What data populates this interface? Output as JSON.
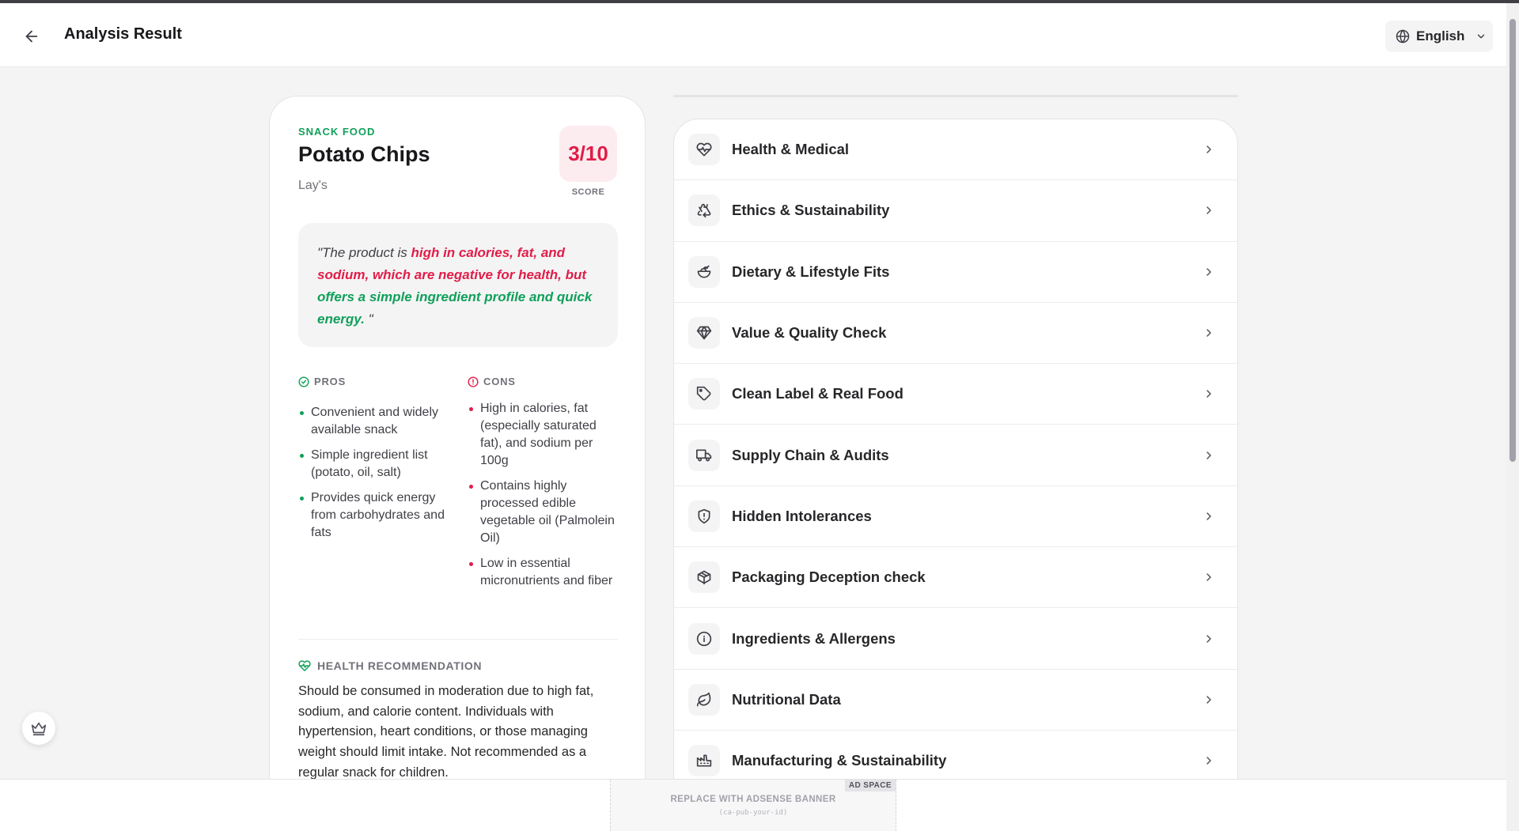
{
  "header": {
    "back_icon": "arrow-left-icon",
    "title": "Analysis Result",
    "language": {
      "icon": "globe-icon",
      "value": "English"
    }
  },
  "product": {
    "category": "SNACK FOOD",
    "name": "Potato Chips",
    "brand": "Lay's",
    "score": "3/10",
    "score_label": "SCORE",
    "summary": {
      "prefix": "\"The product is ",
      "negative": "high in calories, fat, and sodium, which are negative for health, but",
      "positive": " offers a simple ingredient profile and quick energy.",
      "suffix": " \""
    },
    "pros": {
      "heading": "PROS",
      "items": [
        "Convenient and widely available snack",
        "Simple ingredient list (potato, oil, salt)",
        "Provides quick energy from carbohydrates and fats"
      ]
    },
    "cons": {
      "heading": "CONS",
      "items": [
        "High in calories, fat (especially saturated fat), and sodium per 100g",
        "Contains highly processed edible vegetable oil (Palmolein Oil)",
        "Low in essential micronutrients and fiber"
      ]
    },
    "health_recommendation": {
      "heading": "HEALTH RECOMMENDATION",
      "text": "Should be consumed in moderation due to high fat, sodium, and calorie content. Individuals with hypertension, heart conditions, or those managing weight should limit intake. Not recommended as a regular snack for children."
    }
  },
  "sections": [
    {
      "label": "Health & Medical",
      "icon": "heart-pulse-icon"
    },
    {
      "label": "Ethics & Sustainability",
      "icon": "recycle-icon"
    },
    {
      "label": "Dietary & Lifestyle Fits",
      "icon": "salad-bowl-icon"
    },
    {
      "label": "Value & Quality Check",
      "icon": "diamond-icon"
    },
    {
      "label": "Clean Label & Real Food",
      "icon": "tag-icon"
    },
    {
      "label": "Supply Chain & Audits",
      "icon": "truck-icon"
    },
    {
      "label": "Hidden Intolerances",
      "icon": "shield-alert-icon"
    },
    {
      "label": "Packaging Deception check",
      "icon": "package-icon"
    },
    {
      "label": "Ingredients & Allergens",
      "icon": "info-icon"
    },
    {
      "label": "Nutritional Data",
      "icon": "leaf-icon"
    },
    {
      "label": "Manufacturing & Sustainability",
      "icon": "factory-icon"
    }
  ],
  "floating": {
    "icon": "crown-icon"
  },
  "ad": {
    "tag": "AD SPACE",
    "text": "REPLACE WITH ADSENSE BANNER",
    "sub": "(ca-pub-your-id)"
  },
  "colors": {
    "accent_green": "#10a05a",
    "accent_red": "#e11d48",
    "score_bg": "#fdecef"
  }
}
